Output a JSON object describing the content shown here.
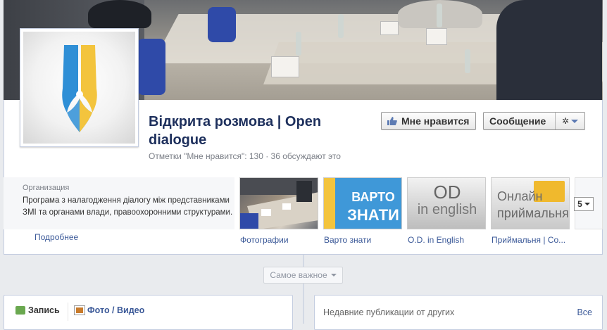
{
  "page": {
    "title": "Відкрита розмова | Open dialogue",
    "likes_line": "Отметки \"Мне нравится\": 130 · 36 обсуждают это"
  },
  "actions": {
    "like_label": "Мне нравится",
    "message_label": "Сообщение"
  },
  "about": {
    "category": "Организация",
    "description": "Програма з налагодження діалогу між представниками ЗМІ та органами влади, правоохоронними структурами.",
    "more_link": "Подробнее"
  },
  "apps": [
    {
      "label": "Фотографии",
      "icon": "photos-thumbnail"
    },
    {
      "label": "Варто знати",
      "icon": "varto-znaty-tile",
      "tile_line1": "ВАРТО",
      "tile_line2": "ЗНАТИ"
    },
    {
      "label": "O.D. in English",
      "icon": "od-in-english-tile",
      "tile_line1": "OD",
      "tile_line2": "in english"
    },
    {
      "label": "Приймальня | Со...",
      "icon": "pryimalnia-tile",
      "tile_line1": "Онлайн",
      "tile_line2": "приймальня"
    }
  ],
  "apps_more_count": "5",
  "timeline": {
    "filter_label": "Самое важное",
    "composer_post": "Запись",
    "composer_media": "Фото / Видео",
    "recent_title": "Недавние публикации от других",
    "recent_all": "Все"
  },
  "colors": {
    "brand_blue": "#3b5998",
    "title_navy": "#1d2f5c",
    "logo_blue": "#2f8fd6",
    "logo_yellow": "#f3c43d"
  }
}
